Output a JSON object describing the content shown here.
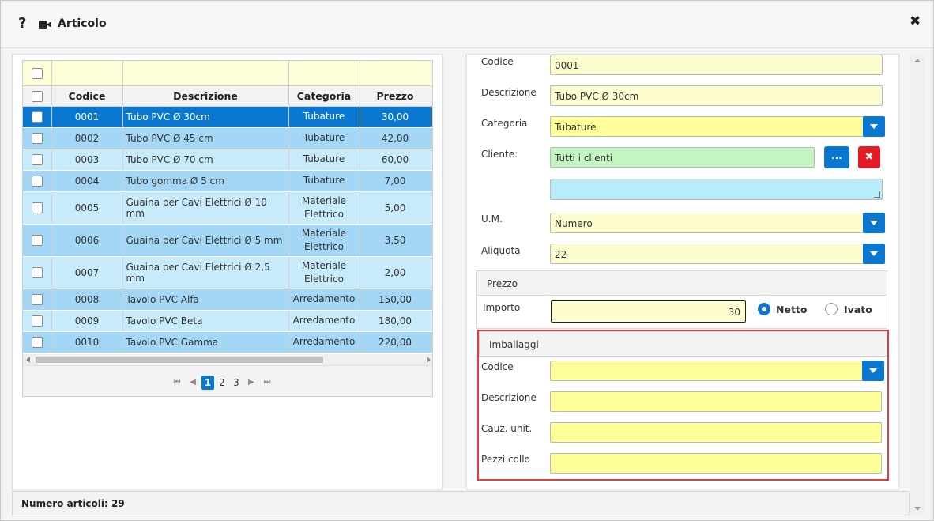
{
  "window": {
    "title": "Articolo",
    "help_glyph": "?",
    "close_glyph": "✖"
  },
  "icons": {
    "help": "question-icon",
    "video": "video-camera-icon",
    "close": "close-icon"
  },
  "grid": {
    "columns": [
      "Codice",
      "Descrizione",
      "Categoria",
      "Prezzo"
    ],
    "rows": [
      {
        "code": "0001",
        "desc": "Tubo PVC Ø 30cm",
        "cat": "Tubature",
        "price": "30,00",
        "selected": true
      },
      {
        "code": "0002",
        "desc": "Tubo PVC Ø 45 cm",
        "cat": "Tubature",
        "price": "42,00"
      },
      {
        "code": "0003",
        "desc": "Tubo PVC Ø 70 cm",
        "cat": "Tubature",
        "price": "60,00"
      },
      {
        "code": "0004",
        "desc": "Tubo gomma Ø 5 cm",
        "cat": "Tubature",
        "price": "7,00"
      },
      {
        "code": "0005",
        "desc": "Guaina per Cavi Elettrici Ø 10 mm",
        "cat_line1": "Materiale",
        "cat_line2": "Elettrico",
        "price": "5,00"
      },
      {
        "code": "0006",
        "desc": "Guaina per Cavi Elettrici Ø 5 mm",
        "cat_line1": "Materiale",
        "cat_line2": "Elettrico",
        "price": "3,50"
      },
      {
        "code": "0007",
        "desc": "Guaina per Cavi Elettrici Ø 2,5 mm",
        "cat_line1": "Materiale",
        "cat_line2": "Elettrico",
        "price": "2,00"
      },
      {
        "code": "0008",
        "desc": "Tavolo PVC Alfa",
        "cat": "Arredamento",
        "price": "150,00"
      },
      {
        "code": "0009",
        "desc": "Tavolo PVC Beta",
        "cat": "Arredamento",
        "price": "180,00"
      },
      {
        "code": "0010",
        "desc": "Tavolo PVC Gamma",
        "cat": "Arredamento",
        "price": "220,00"
      }
    ],
    "pager": {
      "pages": [
        "1",
        "2",
        "3"
      ],
      "current": "1"
    }
  },
  "form": {
    "codice": {
      "label": "Codice",
      "value": "0001"
    },
    "descrizione": {
      "label": "Descrizione",
      "value": "Tubo PVC Ø 30cm"
    },
    "categoria": {
      "label": "Categoria",
      "value": "Tubature"
    },
    "cliente": {
      "label": "Cliente:",
      "value": "Tutti i clienti",
      "browse_label": "...",
      "clear_label": "✖",
      "note": ""
    },
    "um": {
      "label": "U.M.",
      "value": "Numero"
    },
    "aliquota": {
      "label": "Aliquota",
      "value": "22"
    },
    "prezzo": {
      "section_title": "Prezzo",
      "importo_label": "Importo",
      "importo_value": "30",
      "netto_label": "Netto",
      "ivato_label": "Ivato",
      "selected": "Netto"
    },
    "imballaggi": {
      "section_title": "Imballaggi",
      "codice_label": "Codice",
      "codice_value": "",
      "descrizione_label": "Descrizione",
      "descrizione_value": "",
      "cauz_label": "Cauz. unit.",
      "cauz_value": "",
      "pezzi_label": "Pezzi collo",
      "pezzi_value": ""
    }
  },
  "footer": {
    "text": "Numero articoli: 29"
  },
  "colors": {
    "accent": "#0a78d0",
    "danger": "#e41b25",
    "highlight": "#e23c3c",
    "row_a": "#a4d6f5",
    "row_b": "#c8ebfb"
  }
}
